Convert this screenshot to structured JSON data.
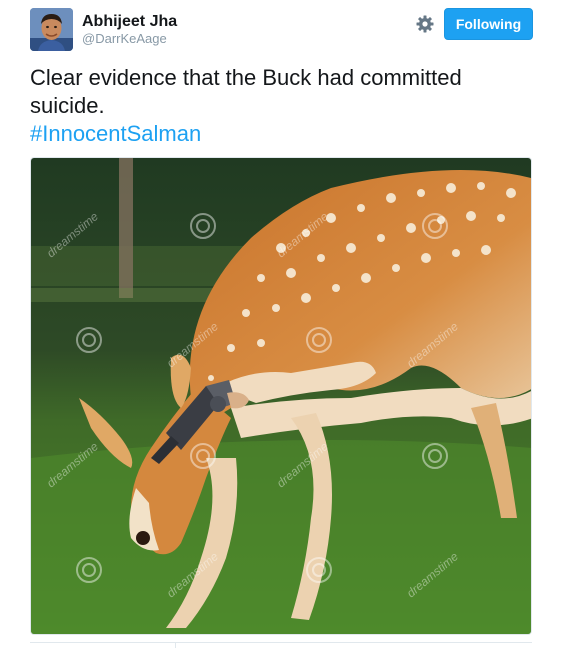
{
  "tweet": {
    "author": {
      "display_name": "Abhijeet Jha",
      "handle": "@DarrKeAage",
      "avatar_icon": "profile-avatar"
    },
    "actions": {
      "settings_icon": "gear-icon",
      "follow_label": "Following"
    },
    "text_lines": [
      "Clear evidence that the Buck had committed",
      "suicide."
    ],
    "hashtag": "#InnocentSalman",
    "media": {
      "watermark": "dreamstime",
      "description_icon": "photo"
    }
  },
  "colors": {
    "accent": "#1da1f2",
    "text": "#14171a",
    "muted": "#8899a6"
  }
}
